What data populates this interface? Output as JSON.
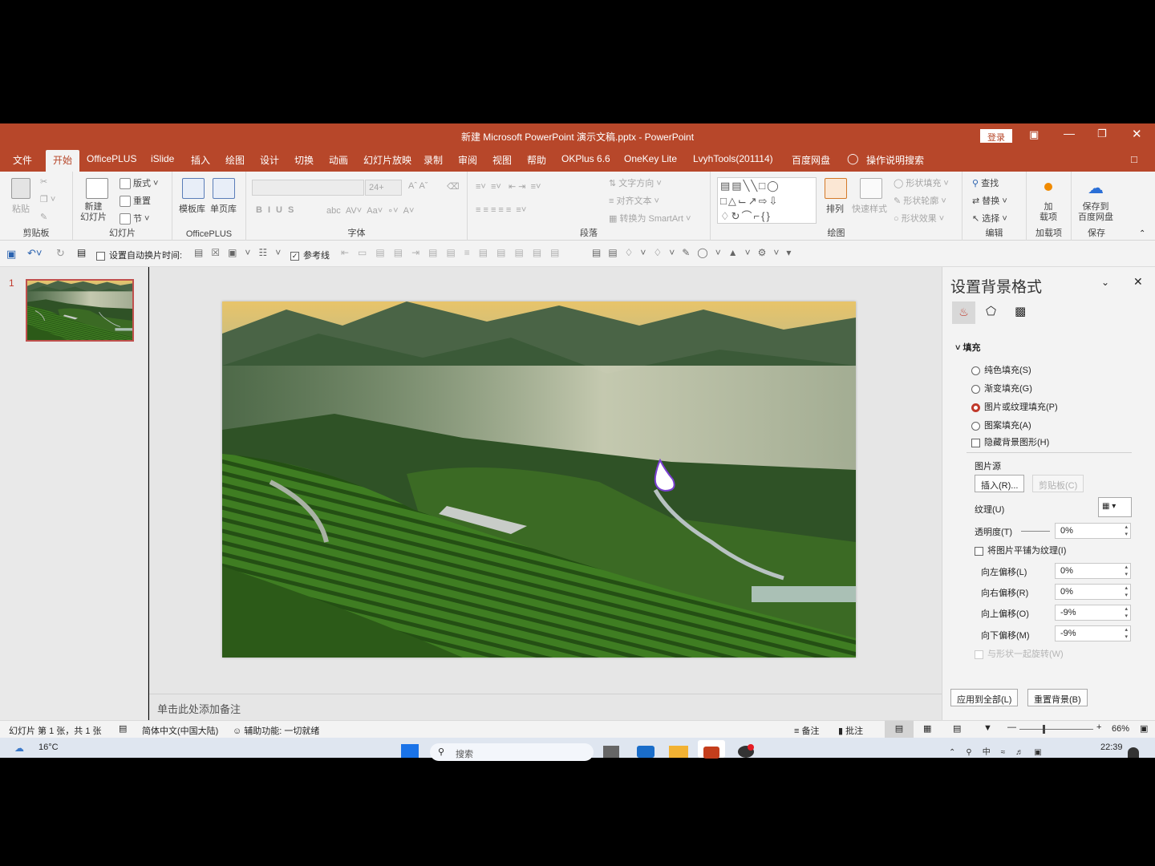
{
  "window": {
    "title": "新建 Microsoft PowerPoint 演示文稿.pptx  -  PowerPoint",
    "login": "登录",
    "brand_color": "#b7472a"
  },
  "tabs": [
    "文件",
    "开始",
    "OfficePLUS",
    "iSlide",
    "插入",
    "绘图",
    "设计",
    "切换",
    "动画",
    "幻灯片放映",
    "录制",
    "审阅",
    "视图",
    "帮助",
    "OKPlus 6.6",
    "OneKey Lite",
    "LvyhTools(201114)",
    "百度网盘"
  ],
  "tell_me": "操作说明搜索",
  "ribbon": {
    "clipboard": {
      "label": "剪贴板",
      "paste": "粘贴"
    },
    "slides": {
      "label": "幻灯片",
      "new_slide": "新建\n幻灯片",
      "layout": "版式",
      "reset": "重置",
      "section": "节"
    },
    "officeplus": {
      "label": "OfficePLUS",
      "template": "模板库",
      "single": "单页库"
    },
    "font": {
      "label": "字体",
      "size": "24+"
    },
    "paragraph": {
      "label": "段落",
      "text_dir": "文字方向",
      "align_text": "对齐文本",
      "smartart": "转换为 SmartArt"
    },
    "drawing": {
      "label": "绘图",
      "arrange": "排列",
      "quick_styles": "快速样式",
      "shape_fill": "形状填充",
      "shape_outline": "形状轮廓",
      "shape_effects": "形状效果"
    },
    "editing": {
      "label": "编辑",
      "find": "查找",
      "replace": "替换",
      "select": "选择"
    },
    "addins": {
      "label": "加载项",
      "addin": "加\n载项"
    },
    "save": {
      "label": "保存",
      "save_to": "保存到\n百度网盘"
    }
  },
  "qat": {
    "auto_switch": "设置自动换片时间:",
    "guides": "参考线"
  },
  "thumbnails": [
    {
      "number": "1"
    }
  ],
  "notes_placeholder": "单击此处添加备注",
  "format_pane": {
    "title": "设置背景格式",
    "section": "填充",
    "options": [
      {
        "label": "纯色填充(S)",
        "checked": false
      },
      {
        "label": "渐变填充(G)",
        "checked": false
      },
      {
        "label": "图片或纹理填充(P)",
        "checked": true
      },
      {
        "label": "图案填充(A)",
        "checked": false
      }
    ],
    "hide_bg": "隐藏背景图形(H)",
    "picture_source": "图片源",
    "insert": "插入(R)...",
    "clipboard": "剪贴板(C)",
    "texture": "纹理(U)",
    "transparency": {
      "label": "透明度(T)",
      "value": "0%"
    },
    "tile": "将图片平铺为纹理(I)",
    "offsets": [
      {
        "label": "向左偏移(L)",
        "value": "0%"
      },
      {
        "label": "向右偏移(R)",
        "value": "0%"
      },
      {
        "label": "向上偏移(O)",
        "value": "-9%"
      },
      {
        "label": "向下偏移(M)",
        "value": "-9%"
      }
    ],
    "rotate": "与形状一起旋转(W)",
    "apply_all": "应用到全部(L)",
    "reset": "重置背景(B)"
  },
  "status": {
    "slide": "幻灯片 第 1 张，共 1 张",
    "lang": "简体中文(中国大陆)",
    "access": "辅助功能: 一切就绪",
    "notes": "备注",
    "comments": "批注",
    "zoom": "66%",
    "zoom_level": 0.66
  },
  "taskbar": {
    "weather": "16°C",
    "search": "搜索",
    "time": "22:39"
  }
}
